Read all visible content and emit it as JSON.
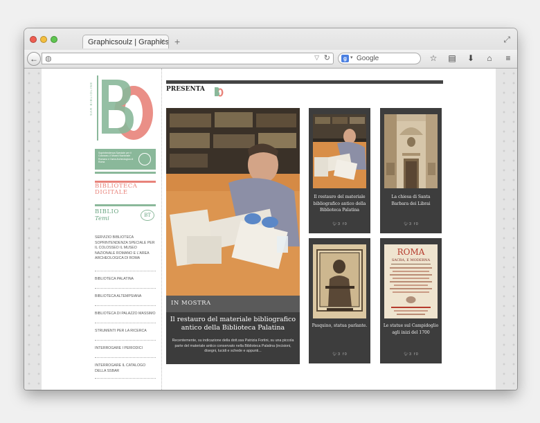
{
  "browser": {
    "tab_title": "Graphicsoulz | Graphicso",
    "tab_close": "×",
    "new_tab": "+",
    "url_value": "",
    "search_placeholder": "Google",
    "search_engine_icon": "google-g-icon"
  },
  "colors": {
    "brand_red": "#e8837a",
    "brand_green": "#8ab89a",
    "dark_card": "#3d3d3d"
  },
  "sidebar": {
    "logo_side_text": "SAR BIBLIOLINE",
    "ssba_text": "Soprintendenza Speciale per il Colosseo, il Museo Nazionale Romano e l'area Archeologica di Roma",
    "biblioteca_digitale": "BIBLIOTECA DIGITALE",
    "biblio": "BIBLIO",
    "temi": "Temi",
    "bt_badge": "BT",
    "menu": [
      "SERVIZIO BIBLIOTECA SOPRINTENDENZA SPECIALE PER IL COLOSSEO IL MUSEO NAZIONALE ROMANO E L'AREA ARCHEOLOGICA DI ROMA",
      "BIBLIOTECA PALATINA",
      "BIBLIOTECA ALTEMPSIANA",
      "BIBLIOTECA DI PALAZZO MASSIMO",
      "STRUMENTI PER LA RICERCA",
      "INTERROGARE I PERIODICI",
      "INTERROGARE IL CATALOGO DELLA SSBAR"
    ]
  },
  "main": {
    "presenta": "PRESENTA",
    "feature": {
      "category": "IN MOSTRA",
      "title": "Il restauro del materiale bibliografico antico della Biblioteca Palatina",
      "excerpt": "Recentemente, su indicazione della dott.ssa Patrizia Fortini, su una piccola parte del materiale antico conservato nella Biblioteca Palatina (incisioni, disegni, lucidi e schede e appunti..."
    },
    "cards": [
      {
        "title": "Il restauro del materiale bibliografico antico della Biblioteca Palatina",
        "likes": "3",
        "shares": "0"
      },
      {
        "title": "La chiesa di Santa Barbara dei Librai",
        "likes": "3",
        "shares": "0"
      },
      {
        "title": "Pasquino, statua parlante.",
        "likes": "3",
        "shares": "0"
      },
      {
        "title": "Le statue sul Campidoglio agli inizi del 1700",
        "likes": "3",
        "shares": "0"
      }
    ]
  }
}
